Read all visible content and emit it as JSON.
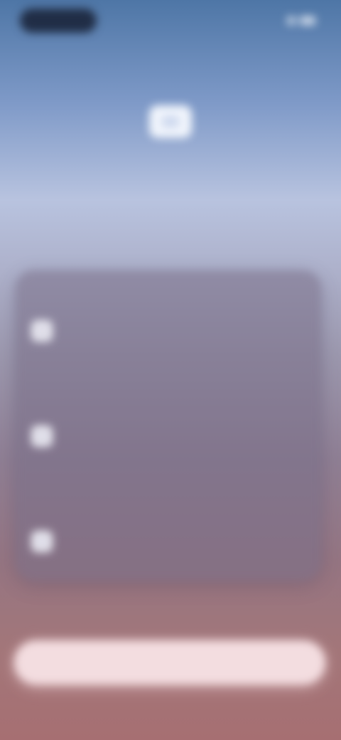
{
  "status_bar": {
    "time": "",
    "indicators": [
      "signal-icon",
      "battery-icon"
    ]
  },
  "header": {
    "overline": "",
    "icon": "app-logo-icon",
    "title": "",
    "subtitle": ""
  },
  "features": {
    "items": [
      {
        "icon": "feature-icon",
        "title": "",
        "description": ""
      },
      {
        "icon": "feature-icon",
        "title": "",
        "description": ""
      },
      {
        "icon": "feature-icon",
        "title": "",
        "description": ""
      }
    ]
  },
  "cta": {
    "label": ""
  },
  "colors": {
    "gradient_top": "#4e76a6",
    "gradient_middle": "#b8c3df",
    "gradient_bottom": "#a66f72",
    "card": "#786e87",
    "button": "#f3dde0"
  }
}
